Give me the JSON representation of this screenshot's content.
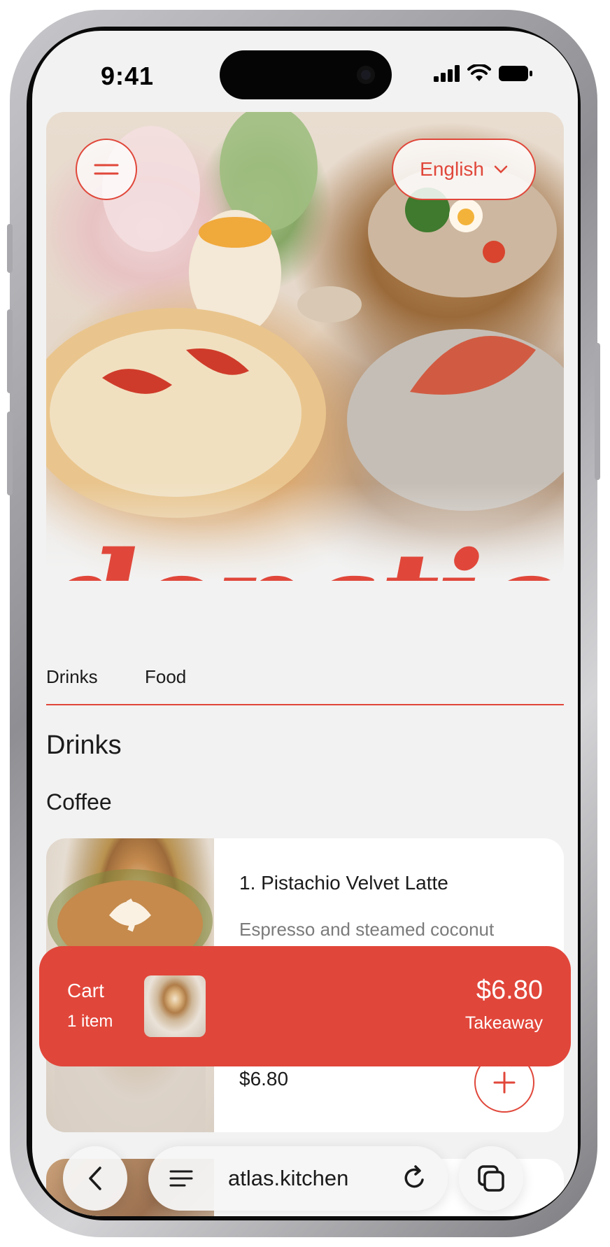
{
  "status_bar": {
    "time": "9:41",
    "icons": [
      "signal-icon",
      "wifi-icon",
      "battery-icon"
    ]
  },
  "hero": {
    "language_selector": "English",
    "brand": "depatio"
  },
  "tabs": [
    "Drinks",
    "Food"
  ],
  "section": {
    "title": "Drinks",
    "subtitle": "Coffee"
  },
  "items": [
    {
      "name": "1. Pistachio Velvet Latte",
      "description": "Espresso and steamed coconut",
      "price": "$6.80"
    }
  ],
  "cart": {
    "label": "Cart",
    "count": "1 item",
    "total": "$6.80",
    "mode": "Takeaway"
  },
  "browser": {
    "url": "atlas.kitchen"
  },
  "colors": {
    "accent": "#e0473a",
    "background": "#f2f2f2"
  }
}
